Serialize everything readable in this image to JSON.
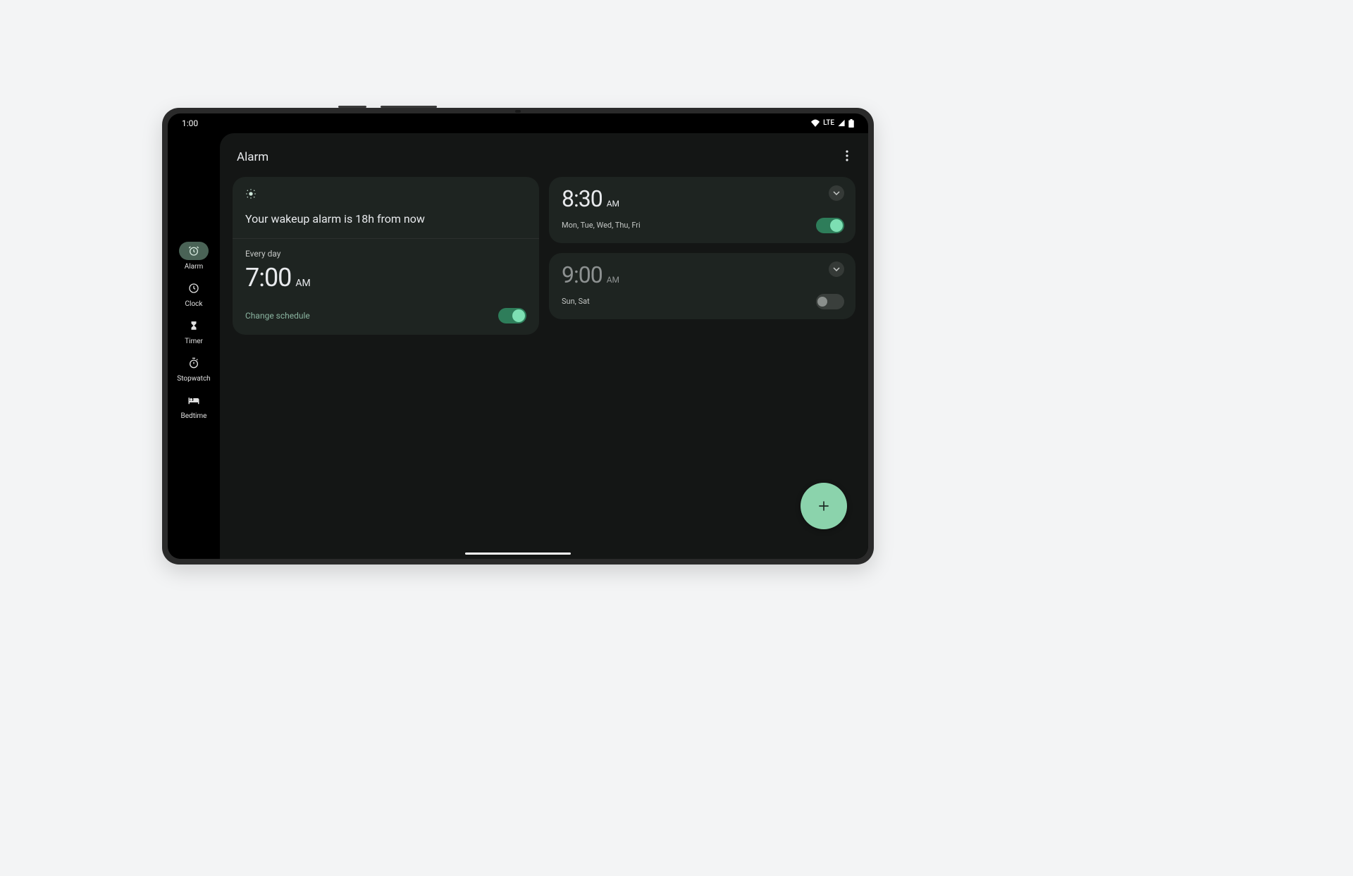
{
  "status": {
    "time": "1:00",
    "network_label": "LTE"
  },
  "nav": {
    "items": [
      {
        "id": "alarm",
        "label": "Alarm",
        "active": true
      },
      {
        "id": "clock",
        "label": "Clock",
        "active": false
      },
      {
        "id": "timer",
        "label": "Timer",
        "active": false
      },
      {
        "id": "stopwatch",
        "label": "Stopwatch",
        "active": false
      },
      {
        "id": "bedtime",
        "label": "Bedtime",
        "active": false
      }
    ]
  },
  "header": {
    "title": "Alarm"
  },
  "wakeup": {
    "message": "Your wakeup alarm is 18h from now",
    "schedule_label": "Every day",
    "time": "7:00",
    "ampm": "AM",
    "change_label": "Change schedule",
    "enabled": true
  },
  "alarms": [
    {
      "time": "8:30",
      "ampm": "AM",
      "days": "Mon, Tue, Wed, Thu, Fri",
      "enabled": true
    },
    {
      "time": "9:00",
      "ampm": "AM",
      "days": "Sun, Sat",
      "enabled": false
    }
  ],
  "fab": {
    "label": "+"
  }
}
